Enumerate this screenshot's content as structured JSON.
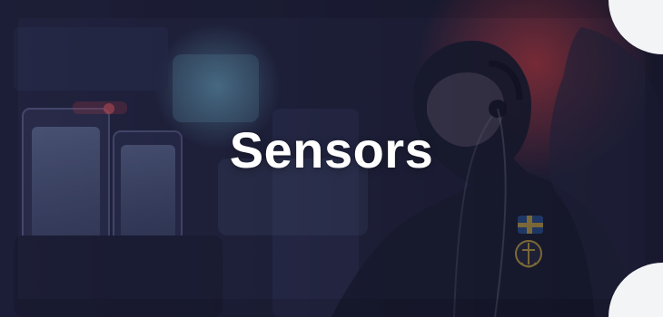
{
  "card": {
    "title": "Sensors"
  },
  "colors": {
    "overlay": "#1c1e3c",
    "title_text": "#ffffff",
    "accent_red": "#ff4a4a",
    "accent_cyan": "#8fe7ff"
  },
  "image": {
    "flag_badge": "swedish-flag-icon",
    "emblem_badge": "swedish-navy-emblem-icon"
  }
}
